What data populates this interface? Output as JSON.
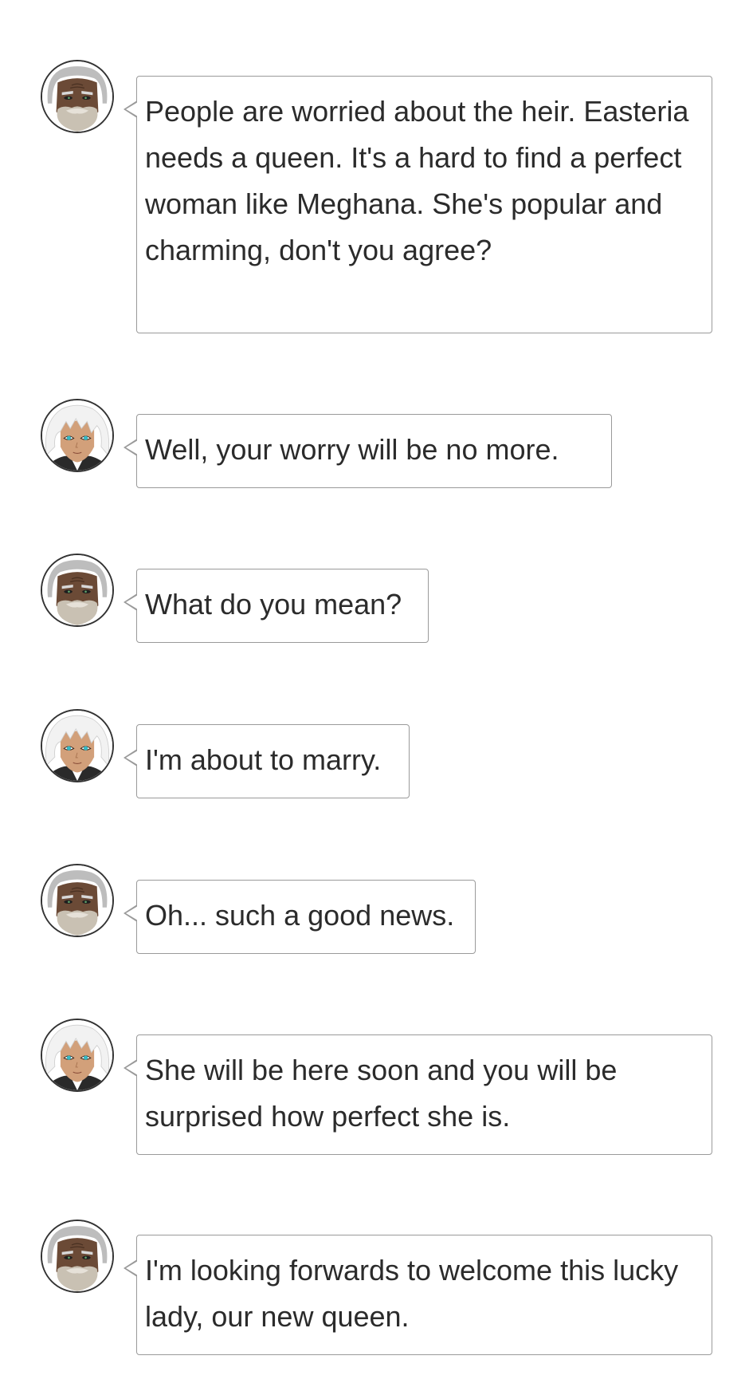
{
  "messages": [
    {
      "speaker": "elder",
      "avatar_icon": "elder-bearded-man-icon",
      "text": "People are worried about the heir. Easteria needs a queen. It's a hard to find a perfect woman like Meghana. She's popular and charming, don't you agree?"
    },
    {
      "speaker": "prince",
      "avatar_icon": "white-haired-man-icon",
      "text": "Well, your worry will be no more."
    },
    {
      "speaker": "elder",
      "avatar_icon": "elder-bearded-man-icon",
      "text": "What do you mean?"
    },
    {
      "speaker": "prince",
      "avatar_icon": "white-haired-man-icon",
      "text": "I'm about to marry."
    },
    {
      "speaker": "elder",
      "avatar_icon": "elder-bearded-man-icon",
      "text": "Oh... such a good news."
    },
    {
      "speaker": "prince",
      "avatar_icon": "white-haired-man-icon",
      "text": "She will be here soon and you will be surprised how perfect she is."
    },
    {
      "speaker": "elder",
      "avatar_icon": "elder-bearded-man-icon",
      "text": "I'm looking forwards to welcome this lucky lady, our new queen."
    }
  ],
  "colors": {
    "bubble_border": "#9a9a9a",
    "text": "#2b2b2b",
    "background": "#ffffff"
  }
}
